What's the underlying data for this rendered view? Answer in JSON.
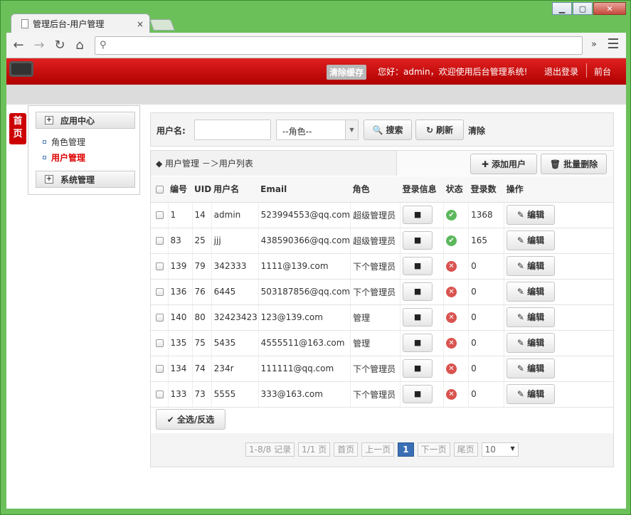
{
  "browser": {
    "tab_title": "管理后台-用户管理",
    "tab_close": "×",
    "window_buttons": [
      "▁",
      "▢",
      "✕"
    ]
  },
  "header": {
    "clear_cache": "清除缓存",
    "welcome": "您好：admin，欢迎使用后台管理系统!",
    "logout": "退出登录",
    "front": "前台",
    "accent_color": "#cc0000"
  },
  "home_tag": "首页",
  "sidebar": {
    "groups": [
      {
        "title": "应用中心",
        "items": [
          "角色管理",
          "用户管理"
        ],
        "active_index": 1
      },
      {
        "title": "系统管理",
        "items": []
      }
    ]
  },
  "search": {
    "username_label": "用户名:",
    "username_value": "",
    "role_select": "--角色--",
    "search_label": "搜索",
    "refresh_label": "刷新",
    "clear_label": "清除"
  },
  "breadcrumb": "◆ 用户管理 －＞用户列表",
  "actions": {
    "add_user": "添加用户",
    "batch_delete": "批量删除"
  },
  "table": {
    "headers": [
      "编号",
      "UID",
      "用户名",
      "Email",
      "角色",
      "登录信息",
      "状态",
      "登录数",
      "操作"
    ],
    "edit_label": "编辑",
    "rows": [
      {
        "id": "1",
        "uid": "14",
        "name": "admin",
        "email": "523994553@qq.com",
        "role": "超级管理员",
        "status": "ok",
        "logins": "1368"
      },
      {
        "id": "83",
        "uid": "25",
        "name": "jjj",
        "email": "438590366@qq.com",
        "role": "超级管理员",
        "status": "ok",
        "logins": "165"
      },
      {
        "id": "139",
        "uid": "79",
        "name": "342333",
        "email": "1111@139.com",
        "role": "下个管理员",
        "status": "no",
        "logins": "0"
      },
      {
        "id": "136",
        "uid": "76",
        "name": "6445",
        "email": "503187856@qq.com",
        "role": "下个管理员",
        "status": "no",
        "logins": "0"
      },
      {
        "id": "140",
        "uid": "80",
        "name": "32423423",
        "email": "123@139.com",
        "role": "管理",
        "status": "no",
        "logins": "0"
      },
      {
        "id": "135",
        "uid": "75",
        "name": "5435",
        "email": "4555511@163.com",
        "role": "管理",
        "status": "no",
        "logins": "0"
      },
      {
        "id": "134",
        "uid": "74",
        "name": "234r",
        "email": "111111@qq.com",
        "role": "下个管理员",
        "status": "no",
        "logins": "0"
      },
      {
        "id": "133",
        "uid": "73",
        "name": "5555",
        "email": "333@163.com",
        "role": "下个管理员",
        "status": "no",
        "logins": "0"
      }
    ]
  },
  "select_all": "全选/反选",
  "pager": {
    "records": "1-8/8 记录",
    "pages": "1/1 页",
    "first": "首页",
    "prev": "上一页",
    "current": "1",
    "next": "下一页",
    "last": "尾页",
    "page_size": "10"
  }
}
